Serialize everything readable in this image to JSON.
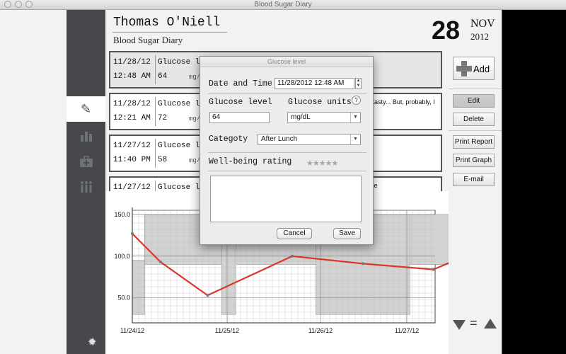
{
  "window": {
    "title": "Blood Sugar Diary"
  },
  "header": {
    "name": "Thomas O'Niell",
    "subtitle": "Blood Sugar Diary",
    "day": "28",
    "month": "NOV",
    "year": "2012"
  },
  "sidebar": {
    "tabs": [
      {
        "name": "pencil-icon",
        "glyph": "✎"
      },
      {
        "name": "bar-chart-icon",
        "glyph": "▮"
      },
      {
        "name": "first-aid-kit-icon",
        "glyph": "✚"
      },
      {
        "name": "people-icon",
        "glyph": "⚇"
      }
    ],
    "settings_icon": "gear-icon"
  },
  "entries": [
    {
      "date": "11/28/12",
      "time": "12:48 AM",
      "label": "Glucose level",
      "value": "64",
      "unit": "mg/dL",
      "note": ""
    },
    {
      "date": "11/28/12",
      "time": "12:21 AM",
      "label": "Glucose level",
      "value": "72",
      "unit": "mg/dL",
      "note": "o tasty... But, probably, I"
    },
    {
      "date": "11/27/12",
      "time": "11:40 PM",
      "label": "Glucose level",
      "value": "58",
      "unit": "mg/dL",
      "note": ""
    },
    {
      "date": "11/27/12",
      "time": "",
      "label": "Glucose level",
      "value": "",
      "unit": "",
      "note": "ake"
    }
  ],
  "toolbar": {
    "add": "Add",
    "edit": "Edit",
    "delete": "Delete",
    "print_report": "Print Report",
    "print_graph": "Print Graph",
    "email": "E-mail",
    "nav_equal": "="
  },
  "dialog": {
    "title": "Glucose level",
    "date_time_label": "Date and Time",
    "date_time_value": "11/28/2012 12:48 AM",
    "glucose_level_label": "Glucose level",
    "glucose_level_value": "64",
    "glucose_units_label": "Glucose units",
    "glucose_units_value": "mg/dL",
    "help": "?",
    "category_label": "Categoty",
    "category_value": "After Lunch",
    "wellbeing_label": "Well-being rating",
    "stars": "★★★★★",
    "rating": 0,
    "notes": "",
    "cancel": "Cancel",
    "save": "Save"
  },
  "colors": {
    "line": "#d9392b",
    "band": "#d2d2d2",
    "sidebar": "#46484c"
  },
  "chart_data": {
    "type": "line",
    "x": [
      "11/24/12",
      "11/24/12",
      "11/25/12",
      "11/25/12",
      "11/26/12",
      "11/26/12",
      "11/27/12",
      "11/27/12",
      "11/27/12"
    ],
    "x_days": [
      0.0,
      0.3,
      0.8,
      1.7,
      2.45,
      3.2,
      3.6,
      3.85,
      3.86
    ],
    "values": [
      127,
      93,
      53,
      100,
      91,
      84,
      103,
      57,
      72
    ],
    "ticks_x": [
      "11/24/12",
      "11/25/12",
      "11/26/12",
      "11/27/12"
    ],
    "ticks_y": [
      "150.0",
      "100.0",
      "50.0"
    ],
    "ylim": [
      20,
      155
    ],
    "grid": true,
    "band": [
      {
        "x0": 0.0,
        "x1": 0.13,
        "lo": 30,
        "hi": 95
      },
      {
        "x0": 0.13,
        "x1": 0.95,
        "lo": 90,
        "hi": 150
      },
      {
        "x0": 0.95,
        "x1": 1.1,
        "lo": 30,
        "hi": 150
      },
      {
        "x0": 1.1,
        "x1": 1.95,
        "lo": 90,
        "hi": 150
      },
      {
        "x0": 1.95,
        "x1": 2.95,
        "lo": 30,
        "hi": 150
      },
      {
        "x0": 2.95,
        "x1": 3.65,
        "lo": 90,
        "hi": 150
      },
      {
        "x0": 3.65,
        "x1": 3.9,
        "lo": 30,
        "hi": 150
      }
    ]
  }
}
